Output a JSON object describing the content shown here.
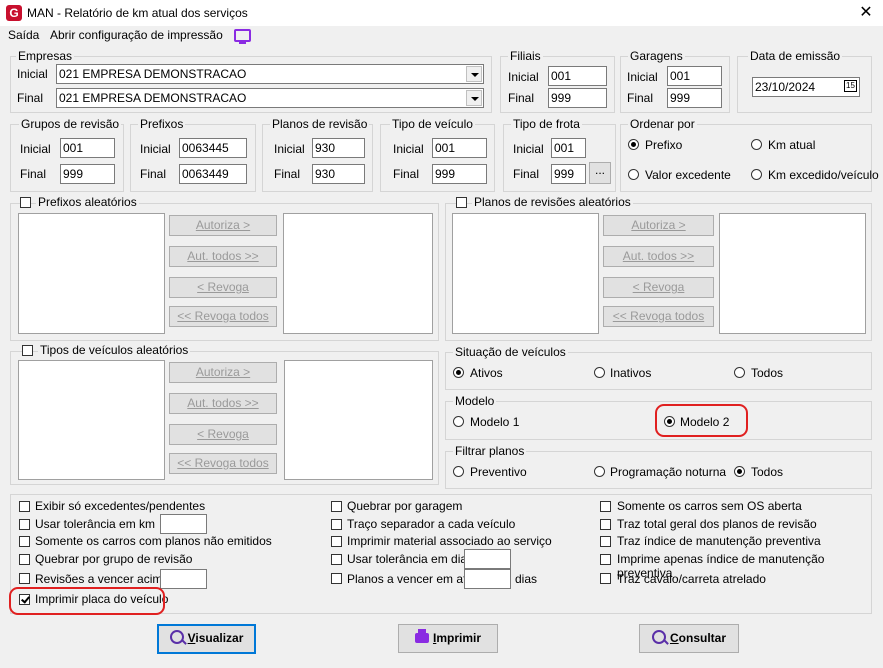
{
  "window": {
    "title": "MAN - Relatório de km atual dos serviços",
    "app_icon": "G",
    "close": "✕"
  },
  "menu": {
    "items": [
      "Saída",
      "Abrir configuração de impressão"
    ]
  },
  "empresas": {
    "label": "Empresas",
    "inicial_label": "Inicial",
    "final_label": "Final",
    "inicial": "021 EMPRESA DEMONSTRACAO",
    "final": "021 EMPRESA DEMONSTRACAO"
  },
  "filiais": {
    "label": "Filiais",
    "inicial_label": "Inicial",
    "final_label": "Final",
    "inicial": "001",
    "final": "999"
  },
  "garagens": {
    "label": "Garagens",
    "inicial_label": "Inicial",
    "final_label": "Final",
    "inicial": "001",
    "final": "999"
  },
  "data_emissao": {
    "label": "Data de emissão",
    "value": "23/10/2024",
    "cal": "15"
  },
  "grupos": {
    "label": "Grupos de revisão",
    "inicial_label": "Inicial",
    "final_label": "Final",
    "inicial": "001",
    "final": "999"
  },
  "prefixos": {
    "label": "Prefixos",
    "inicial_label": "Inicial",
    "final_label": "Final",
    "inicial": "0063445",
    "final": "0063449"
  },
  "planos": {
    "label": "Planos de revisão",
    "inicial_label": "Inicial",
    "final_label": "Final",
    "inicial": "930",
    "final": "930"
  },
  "tipo_veiculo": {
    "label": "Tipo de veículo",
    "inicial_label": "Inicial",
    "final_label": "Final",
    "inicial": "001",
    "final": "999"
  },
  "tipo_frota": {
    "label": "Tipo de frota",
    "inicial_label": "Inicial",
    "final_label": "Final",
    "inicial": "001",
    "final": "999",
    "ellipsis": "..."
  },
  "ordenar": {
    "label": "Ordenar por",
    "options": [
      "Prefixo",
      "Km atual",
      "Valor excedente",
      "Km excedido/veículo"
    ],
    "selected": "Prefixo"
  },
  "aleatorios": {
    "prefixos": "Prefixos aleatórios",
    "planos": "Planos de revisões aleatórios",
    "tipos": "Tipos de veículos aleatórios",
    "buttons": [
      "Autoriza >",
      "Aut. todos >>",
      "< Revoga",
      "<< Revoga todos"
    ]
  },
  "situacao": {
    "label": "Situação de veículos",
    "options": [
      "Ativos",
      "Inativos",
      "Todos"
    ],
    "selected": "Ativos"
  },
  "modelo": {
    "label": "Modelo",
    "options": [
      "Modelo 1",
      "Modelo 2"
    ],
    "selected": "Modelo 2"
  },
  "filtrar": {
    "label": "Filtrar planos",
    "options": [
      "Preventivo",
      "Programação noturna",
      "Todos"
    ],
    "selected": "Todos"
  },
  "options": {
    "col1": [
      "Exibir só excedentes/pendentes",
      "Usar tolerância em km",
      "Somente os carros com planos não emitidos",
      "Quebrar por grupo de revisão",
      "Revisões a vencer acima",
      "Imprimir placa do veículo"
    ],
    "col2": [
      "Quebrar por garagem",
      "Traço separador a cada veículo",
      "Imprimir material associado ao serviço",
      "Usar tolerância em dias",
      "Planos a vencer em até"
    ],
    "col2_suffix": "dias",
    "col3": [
      "Somente os carros sem OS aberta",
      "Traz total geral dos planos de revisão",
      "Traz índice de manutenção preventiva",
      "Imprime apenas índice de manutenção preventiva",
      "Traz cavalo/carreta atrelado"
    ],
    "checked": "Imprimir placa do veículo"
  },
  "actions": {
    "visualizar_u": "V",
    "visualizar_rest": "isualizar",
    "imprimir_u": "I",
    "imprimir_rest": "mprimir",
    "consultar_u": "C",
    "consultar_rest": "onsultar"
  },
  "colors": {
    "highlight": "#e02020",
    "focus": "#0078d7",
    "icon": "#5a2fa8"
  }
}
